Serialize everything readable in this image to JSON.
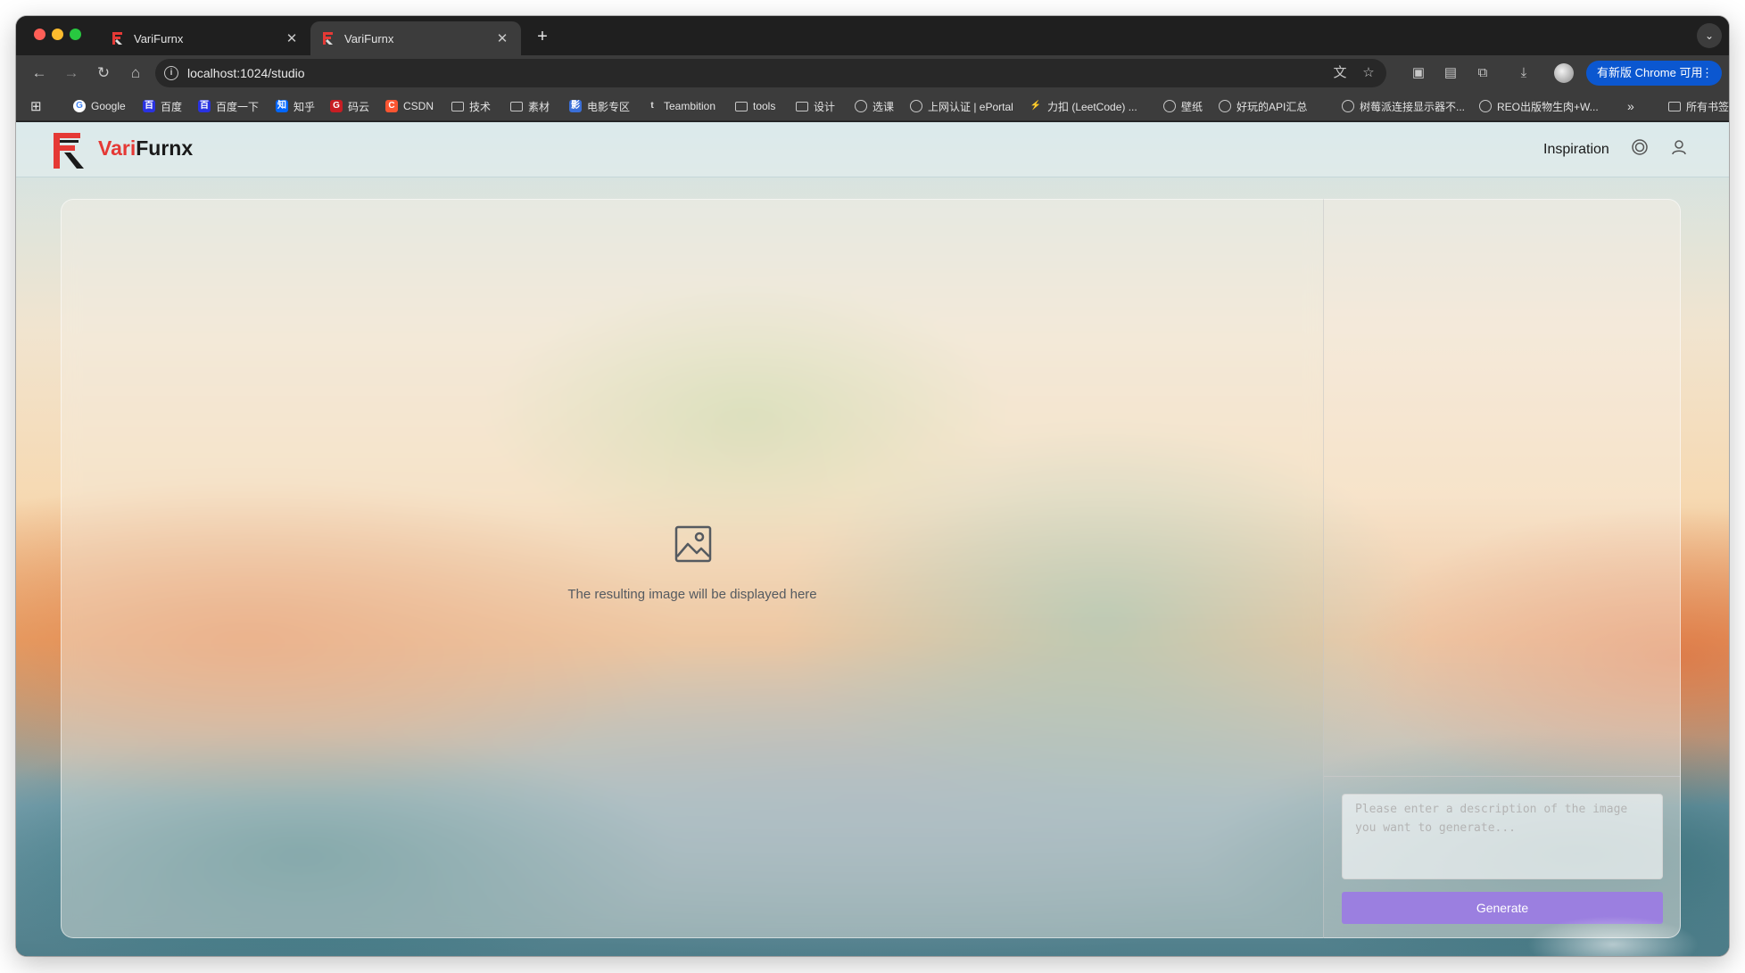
{
  "browser": {
    "tabs": [
      {
        "title": "VariFurnx",
        "close": "✕"
      },
      {
        "title": "VariFurnx",
        "close": "✕"
      }
    ],
    "new_tab": "+",
    "tab_menu": "⌄",
    "url": "localhost:1024/studio",
    "update_button": "有新版 Chrome 可用",
    "update_menu": "⋮"
  },
  "bookmarks": {
    "apps": "⊞",
    "items": [
      {
        "label": "Google",
        "icon": "G"
      },
      {
        "label": "百度",
        "icon": "百"
      },
      {
        "label": "百度一下",
        "icon": "百"
      },
      {
        "label": "知乎",
        "icon": "知"
      },
      {
        "label": "码云",
        "icon": "G"
      },
      {
        "label": "CSDN",
        "icon": "C"
      },
      {
        "label": "技术",
        "icon": ""
      },
      {
        "label": "素材",
        "icon": ""
      },
      {
        "label": "电影专区",
        "icon": "影"
      },
      {
        "label": "Teambition",
        "icon": "t"
      },
      {
        "label": "tools",
        "icon": ""
      },
      {
        "label": "设计",
        "icon": ""
      },
      {
        "label": "选课",
        "icon": ""
      },
      {
        "label": "上网认证 | ePortal",
        "icon": ""
      },
      {
        "label": "力扣 (LeetCode) ...",
        "icon": "⚡"
      },
      {
        "label": "壁纸",
        "icon": ""
      },
      {
        "label": "好玩的API汇总",
        "icon": ""
      },
      {
        "label": "树莓派连接显示器不...",
        "icon": ""
      },
      {
        "label": "REO出版物生肉+W...",
        "icon": ""
      }
    ],
    "overflow": "»",
    "all_bookmarks": "所有书签"
  },
  "app": {
    "brand_part1": "Vari",
    "brand_part2": "Furnx",
    "nav_inspiration": "Inspiration",
    "result_placeholder": "The resulting image will be displayed here",
    "prompt_placeholder": "Please enter a description of the image you want to generate...",
    "generate_label": "Generate"
  },
  "colors": {
    "brand_red": "#e53935",
    "generate_button": "#9b7fe0",
    "update_button": "#0b57d0"
  }
}
